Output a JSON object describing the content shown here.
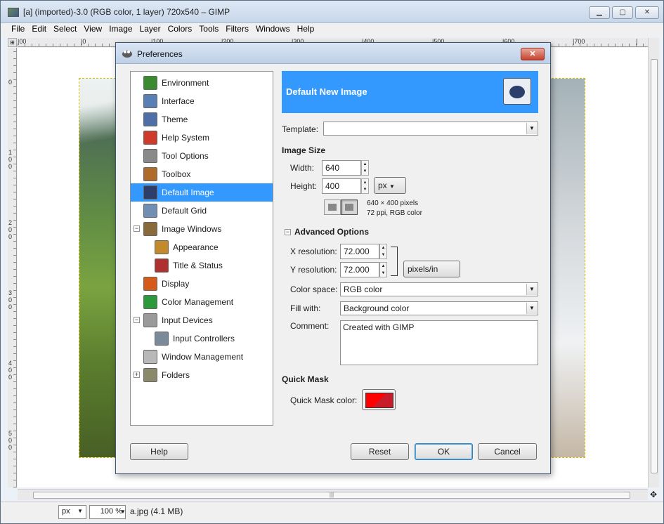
{
  "window": {
    "title": "[a] (imported)-3.0 (RGB color, 1 layer) 720x540 – GIMP",
    "controls": {
      "minimize": "▁",
      "maximize": "▢",
      "close": "✕"
    }
  },
  "menubar": [
    "File",
    "Edit",
    "Select",
    "View",
    "Image",
    "Layer",
    "Colors",
    "Tools",
    "Filters",
    "Windows",
    "Help"
  ],
  "rulers": {
    "corner": "⊞",
    "top_ticks": [
      "|00",
      "|0",
      "|100",
      "|200",
      "|300",
      "|400",
      "|500",
      "|600",
      "|700",
      "|"
    ],
    "left_ticks": [
      "0",
      "100",
      "200",
      "300",
      "400",
      "500"
    ]
  },
  "statusbar": {
    "unit": "px",
    "zoom": "100 %",
    "text": "a.jpg (4.1 MB)",
    "unit_arrow": "▼",
    "zoom_arrow": "▼"
  },
  "navigation": {
    "corner_icon": "✥",
    "hscroll_grip": "|||",
    "vscroll_grip": "≡"
  },
  "preferences": {
    "title": "Preferences",
    "close_label": "✕",
    "tree": [
      {
        "label": "Environment",
        "icon": "environment-icon",
        "color": "#3a8a2e"
      },
      {
        "label": "Interface",
        "icon": "interface-icon",
        "color": "#5a7fb6"
      },
      {
        "label": "Theme",
        "icon": "theme-icon",
        "color": "#4f6fa8"
      },
      {
        "label": "Help System",
        "icon": "help-system-icon",
        "color": "#d03a2a"
      },
      {
        "label": "Tool Options",
        "icon": "tool-options-icon",
        "color": "#8a8a8a"
      },
      {
        "label": "Toolbox",
        "icon": "toolbox-icon",
        "color": "#b06a2a"
      },
      {
        "label": "Default Image",
        "icon": "default-image-icon",
        "color": "#2b3f6a"
      },
      {
        "label": "Default Grid",
        "icon": "default-grid-icon",
        "color": "#6f8fb5"
      },
      {
        "label": "Image Windows",
        "icon": "image-windows-icon",
        "color": "#8a6a3a"
      },
      {
        "label": "Appearance",
        "icon": "appearance-icon",
        "color": "#c28a2a"
      },
      {
        "label": "Title & Status",
        "icon": "title-status-icon",
        "color": "#b03030"
      },
      {
        "label": "Display",
        "icon": "display-icon",
        "color": "#d65a1a"
      },
      {
        "label": "Color Management",
        "icon": "color-management-icon",
        "color": "#2a9a3a"
      },
      {
        "label": "Input Devices",
        "icon": "input-devices-icon",
        "color": "#9a9a9a"
      },
      {
        "label": "Input Controllers",
        "icon": "input-controllers-icon",
        "color": "#7a8a9a"
      },
      {
        "label": "Window Management",
        "icon": "window-management-icon",
        "color": "#b8b8b8"
      },
      {
        "label": "Folders",
        "icon": "folders-icon",
        "color": "#8a8a6a"
      }
    ],
    "tree_expanders": {
      "collapse": "−",
      "expand": "+"
    },
    "page": {
      "header": "Default New Image",
      "template_label": "Template:",
      "template_value": "",
      "image_size": "Image Size",
      "width_label": "Width:",
      "width_value": "640",
      "height_label": "Height:",
      "height_value": "400",
      "size_unit": "px",
      "info_line1": "640 × 400 pixels",
      "info_line2": "72 ppi, RGB color",
      "advanced": "Advanced Options",
      "advanced_expander": "−",
      "xres_label": "X resolution:",
      "xres_value": "72.000",
      "yres_label": "Y resolution:",
      "yres_value": "72.000",
      "res_unit": "pixels/in",
      "colorspace_label": "Color space:",
      "colorspace_value": "RGB color",
      "fill_label": "Fill with:",
      "fill_value": "Background color",
      "comment_label": "Comment:",
      "comment_value": "Created with GIMP",
      "quickmask": "Quick Mask",
      "quickmask_color_label": "Quick Mask color:",
      "quickmask_color": "#ff0000"
    },
    "buttons": {
      "help": "Help",
      "reset": "Reset",
      "ok": "OK",
      "cancel": "Cancel"
    }
  }
}
